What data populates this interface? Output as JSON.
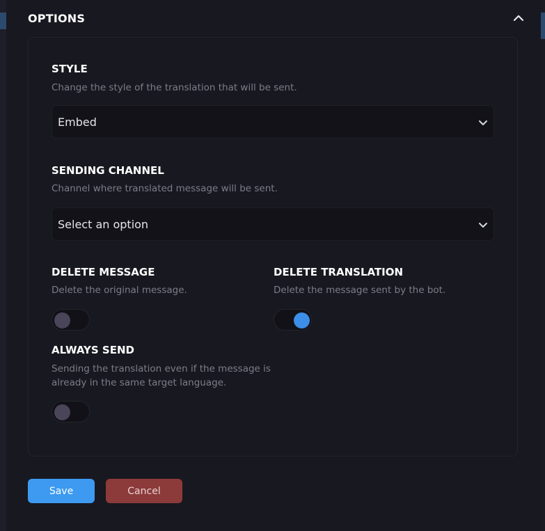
{
  "section": {
    "title": "OPTIONS"
  },
  "fields": {
    "style": {
      "title": "STYLE",
      "description": "Change the style of the translation that will be sent.",
      "value": "Embed"
    },
    "sending_channel": {
      "title": "SENDING CHANNEL",
      "description": "Channel where translated message will be sent.",
      "value": "Select an option"
    },
    "delete_message": {
      "title": "DELETE MESSAGE",
      "description": "Delete the original message.",
      "enabled": false
    },
    "delete_translation": {
      "title": "DELETE TRANSLATION",
      "description": "Delete the message sent by the bot.",
      "enabled": true
    },
    "always_send": {
      "title": "ALWAYS SEND",
      "description_line1": "Sending the translation even if the message is",
      "description_line2": "already in the same target language.",
      "enabled": false
    }
  },
  "actions": {
    "save_label": "Save",
    "cancel_label": "Cancel"
  },
  "colors": {
    "accent": "#3d9af0",
    "toggle_on": "#3d8ee8",
    "toggle_off": "#4a4558",
    "danger": "#8d3a3a",
    "muted_text": "#7d7d88"
  },
  "icons": {
    "collapse": "chevron-up-icon",
    "dropdown": "chevron-down-icon"
  }
}
